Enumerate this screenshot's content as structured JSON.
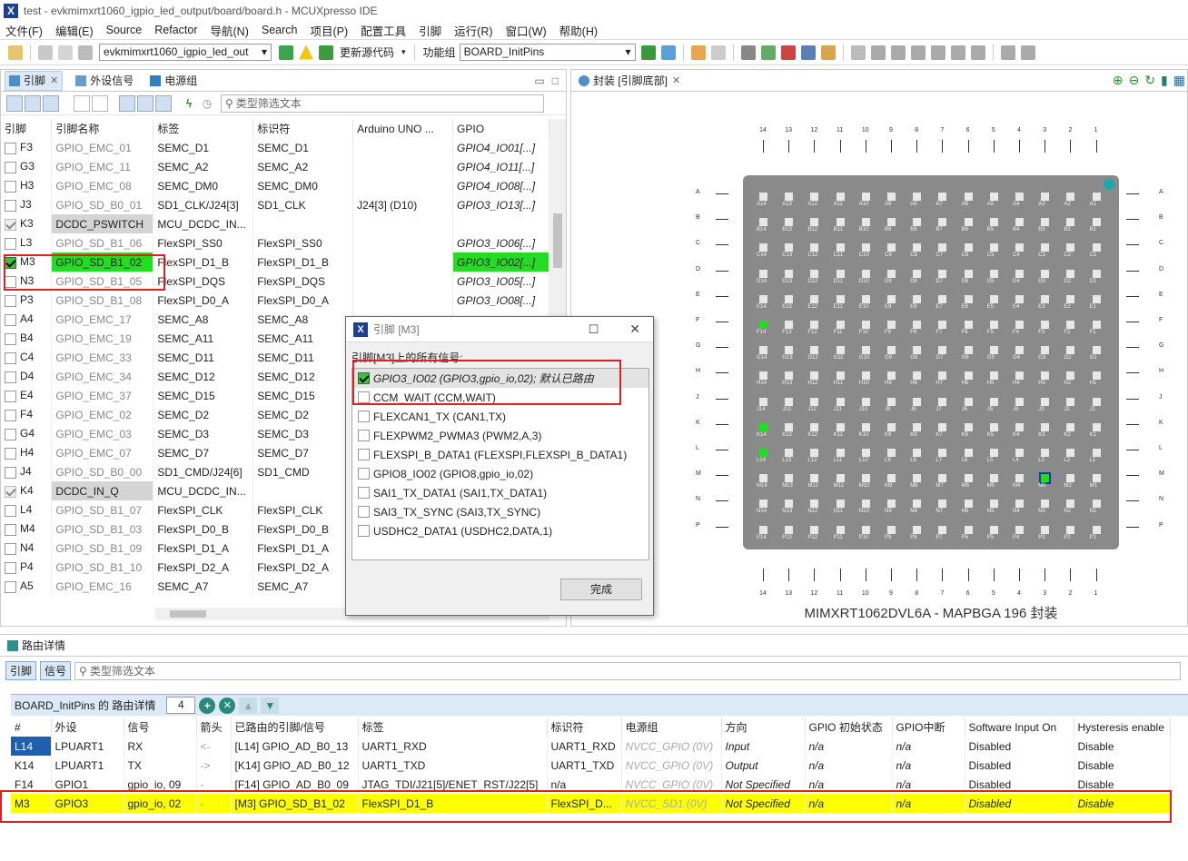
{
  "window": {
    "title": "test - evkmimxrt1060_igpio_led_output/board/board.h - MCUXpresso IDE"
  },
  "menu": [
    "文件(F)",
    "编辑(E)",
    "Source",
    "Refactor",
    "导航(N)",
    "Search",
    "项目(P)",
    "配置工具",
    "引脚",
    "运行(R)",
    "窗口(W)",
    "帮助(H)"
  ],
  "toolbar": {
    "project": "evkmimxrt1060_igpio_led_out",
    "update_label": "更新源代码",
    "func_group_label": "功能组",
    "func_group": "BOARD_InitPins"
  },
  "pins_view": {
    "tabs": [
      "引脚",
      "外设信号",
      "电源组"
    ],
    "filter_placeholder": "类型筛选文本",
    "columns": [
      "引脚",
      "引脚名称",
      "标签",
      "标识符",
      "Arduino UNO ...",
      "GPIO"
    ],
    "rows": [
      {
        "pin": "F3",
        "name": "GPIO_EMC_01",
        "label": "SEMC_D1",
        "id": "SEMC_D1",
        "ard": "",
        "gpio": "GPIO4_IO01[...]"
      },
      {
        "pin": "G3",
        "name": "GPIO_EMC_11",
        "label": "SEMC_A2",
        "id": "SEMC_A2",
        "ard": "",
        "gpio": "GPIO4_IO11[...]"
      },
      {
        "pin": "H3",
        "name": "GPIO_EMC_08",
        "label": "SEMC_DM0",
        "id": "SEMC_DM0",
        "ard": "",
        "gpio": "GPIO4_IO08[...]"
      },
      {
        "pin": "J3",
        "name": "GPIO_SD_B0_01",
        "label": "SD1_CLK/J24[3]",
        "id": "SD1_CLK",
        "ard": "J24[3] (D10)",
        "gpio": "GPIO3_IO13[...]"
      },
      {
        "pin": "K3",
        "name": "DCDC_PSWITCH",
        "label": "MCU_DCDC_IN...",
        "id": "",
        "ard": "",
        "gpio": ""
      },
      {
        "pin": "L3",
        "name": "GPIO_SD_B1_06",
        "label": "FlexSPI_SS0",
        "id": "FlexSPI_SS0",
        "ard": "",
        "gpio": "GPIO3_IO06[...]"
      },
      {
        "pin": "M3",
        "name": "GPIO_SD_B1_02",
        "label": "FlexSPI_D1_B",
        "id": "FlexSPI_D1_B",
        "ard": "",
        "gpio": "GPIO3_IO02[...]"
      },
      {
        "pin": "N3",
        "name": "GPIO_SD_B1_05",
        "label": "FlexSPI_DQS",
        "id": "FlexSPI_DQS",
        "ard": "",
        "gpio": "GPIO3_IO05[...]"
      },
      {
        "pin": "P3",
        "name": "GPIO_SD_B1_08",
        "label": "FlexSPI_D0_A",
        "id": "FlexSPI_D0_A",
        "ard": "",
        "gpio": "GPIO3_IO08[...]"
      },
      {
        "pin": "A4",
        "name": "GPIO_EMC_17",
        "label": "SEMC_A8",
        "id": "SEMC_A8",
        "ard": "",
        "gpio": ""
      },
      {
        "pin": "B4",
        "name": "GPIO_EMC_19",
        "label": "SEMC_A11",
        "id": "SEMC_A11",
        "ard": "",
        "gpio": ""
      },
      {
        "pin": "C4",
        "name": "GPIO_EMC_33",
        "label": "SEMC_D11",
        "id": "SEMC_D11",
        "ard": "",
        "gpio": ""
      },
      {
        "pin": "D4",
        "name": "GPIO_EMC_34",
        "label": "SEMC_D12",
        "id": "SEMC_D12",
        "ard": "",
        "gpio": ""
      },
      {
        "pin": "E4",
        "name": "GPIO_EMC_37",
        "label": "SEMC_D15",
        "id": "SEMC_D15",
        "ard": "",
        "gpio": ""
      },
      {
        "pin": "F4",
        "name": "GPIO_EMC_02",
        "label": "SEMC_D2",
        "id": "SEMC_D2",
        "ard": "",
        "gpio": ""
      },
      {
        "pin": "G4",
        "name": "GPIO_EMC_03",
        "label": "SEMC_D3",
        "id": "SEMC_D3",
        "ard": "",
        "gpio": ""
      },
      {
        "pin": "H4",
        "name": "GPIO_EMC_07",
        "label": "SEMC_D7",
        "id": "SEMC_D7",
        "ard": "",
        "gpio": ""
      },
      {
        "pin": "J4",
        "name": "GPIO_SD_B0_00",
        "label": "SD1_CMD/J24[6]",
        "id": "SD1_CMD",
        "ard": "",
        "gpio": ""
      },
      {
        "pin": "K4",
        "name": "DCDC_IN_Q",
        "label": "MCU_DCDC_IN...",
        "id": "",
        "ard": "",
        "gpio": ""
      },
      {
        "pin": "L4",
        "name": "GPIO_SD_B1_07",
        "label": "FlexSPI_CLK",
        "id": "FlexSPI_CLK",
        "ard": "",
        "gpio": ""
      },
      {
        "pin": "M4",
        "name": "GPIO_SD_B1_03",
        "label": "FlexSPI_D0_B",
        "id": "FlexSPI_D0_B",
        "ard": "",
        "gpio": ""
      },
      {
        "pin": "N4",
        "name": "GPIO_SD_B1_09",
        "label": "FlexSPI_D1_A",
        "id": "FlexSPI_D1_A",
        "ard": "",
        "gpio": ""
      },
      {
        "pin": "P4",
        "name": "GPIO_SD_B1_10",
        "label": "FlexSPI_D2_A",
        "id": "FlexSPI_D2_A",
        "ard": "",
        "gpio": ""
      },
      {
        "pin": "A5",
        "name": "GPIO_EMC_16",
        "label": "SEMC_A7",
        "id": "SEMC_A7",
        "ard": "",
        "gpio": ""
      }
    ]
  },
  "package_view": {
    "tab": "封装 [引脚底部]",
    "caption": "MIMXRT1062DVL6A - MAPBGA 196 封装",
    "columns": [
      "14",
      "13",
      "12",
      "11",
      "10",
      "9",
      "8",
      "7",
      "6",
      "5",
      "4",
      "3",
      "2",
      "1"
    ],
    "rows": [
      "A",
      "B",
      "C",
      "D",
      "E",
      "F",
      "G",
      "H",
      "J",
      "K",
      "L",
      "M",
      "N",
      "P"
    ]
  },
  "dialog": {
    "title": "引脚 [M3]",
    "prompt": "引脚[M3]上的所有信号:",
    "items": [
      {
        "text": "GPIO3_IO02 (GPIO3,gpio_io,02); 默认已路由",
        "checked": true
      },
      {
        "text": "CCM_WAIT (CCM,WAIT)",
        "checked": false
      },
      {
        "text": "FLEXCAN1_TX (CAN1,TX)",
        "checked": false
      },
      {
        "text": "FLEXPWM2_PWMA3 (PWM2,A,3)",
        "checked": false
      },
      {
        "text": "FLEXSPI_B_DATA1 (FLEXSPI,FLEXSPI_B_DATA1)",
        "checked": false
      },
      {
        "text": "GPIO8_IO02 (GPIO8,gpio_io,02)",
        "checked": false
      },
      {
        "text": "SAI1_TX_DATA1 (SAI1,TX_DATA1)",
        "checked": false
      },
      {
        "text": "SAI3_TX_SYNC (SAI3,TX_SYNC)",
        "checked": false
      },
      {
        "text": "USDHC2_DATA1 (USDHC2,DATA,1)",
        "checked": false
      }
    ],
    "done": "完成"
  },
  "routing": {
    "tab": "路由详情",
    "btn_pin": "引脚",
    "btn_signal": "信号",
    "filter_placeholder": "类型筛选文本",
    "header_title": "BOARD_InitPins 的 路由详情",
    "count": "4",
    "columns": [
      "#",
      "外设",
      "信号",
      "箭头",
      "已路由的引脚/信号",
      "标签",
      "标识符",
      "电源组",
      "方向",
      "GPIO 初始状态",
      "GPIO中断",
      "Software Input On",
      "Hysteresis enable"
    ],
    "rows": [
      {
        "n": "L14",
        "per": "LPUART1",
        "sig": "RX",
        "arrow": "<-",
        "routed": "[L14] GPIO_AD_B0_13",
        "label": "UART1_RXD",
        "id": "UART1_RXD",
        "pwr": "NVCC_GPIO (0V)",
        "dir": "Input",
        "init": "n/a",
        "irq": "n/a",
        "sio": "Disabled",
        "hys": "Disable"
      },
      {
        "n": "K14",
        "per": "LPUART1",
        "sig": "TX",
        "arrow": "->",
        "routed": "[K14] GPIO_AD_B0_12",
        "label": "UART1_TXD",
        "id": "UART1_TXD",
        "pwr": "NVCC_GPIO (0V)",
        "dir": "Output",
        "init": "n/a",
        "irq": "n/a",
        "sio": "Disabled",
        "hys": "Disable"
      },
      {
        "n": "F14",
        "per": "GPIO1",
        "sig": "gpio_io, 09",
        "arrow": "-",
        "routed": "[F14] GPIO_AD_B0_09",
        "label": "JTAG_TDI/J21[5]/ENET_RST/J22[5]",
        "id": "n/a",
        "pwr": "NVCC_GPIO (0V)",
        "dir": "Not Specified",
        "init": "n/a",
        "irq": "n/a",
        "sio": "Disabled",
        "hys": "Disable"
      },
      {
        "n": "M3",
        "per": "GPIO3",
        "sig": "gpio_io, 02",
        "arrow": "-",
        "routed": "[M3] GPIO_SD_B1_02",
        "label": "FlexSPI_D1_B",
        "id": "FlexSPI_D...",
        "pwr": "NVCC_SD1 (0V)",
        "dir": "Not Specified",
        "init": "n/a",
        "irq": "n/a",
        "sio": "Disabled",
        "hys": "Disable"
      }
    ]
  }
}
